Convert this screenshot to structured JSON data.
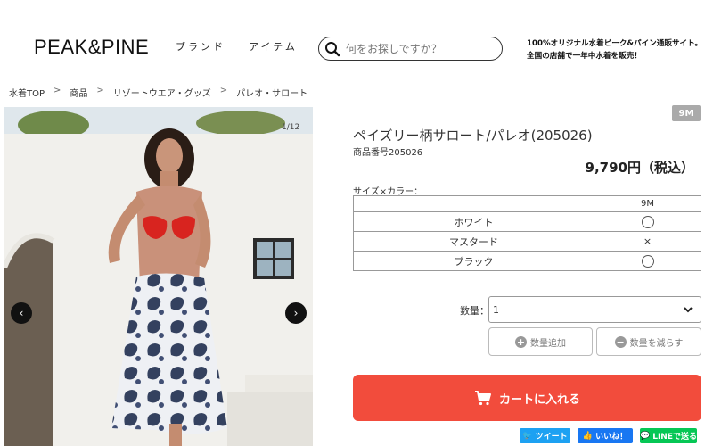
{
  "header": {
    "logo": "PEAK&PINE",
    "nav": [
      "ブランド",
      "アイテム"
    ],
    "search_placeholder": "何をお探しですか？",
    "tagline_1": "100%オリジナル水着ピーク&パイン通販サイト。",
    "tagline_2": "全国の店舗で一年中水着を販売！"
  },
  "breadcrumb": [
    "水着TOP",
    "商品",
    "リゾートウエア・グッズ",
    "パレオ・サロート"
  ],
  "gallery": {
    "counter": "1/12",
    "prev": "‹",
    "next": "›"
  },
  "product": {
    "size_badge": "9M",
    "title": "ペイズリー柄サロート/パレオ(205026)",
    "code": "商品番号205026",
    "price": "9,790円（税込）",
    "variant_label": "サイズ×カラー：",
    "size_header": "9M",
    "variants": [
      {
        "color": "ホワイト",
        "stock": "available"
      },
      {
        "color": "マスタード",
        "stock": "×"
      },
      {
        "color": "ブラック",
        "stock": "available"
      }
    ]
  },
  "quantity": {
    "label": "数量：",
    "value": "1",
    "add_label": "数量追加",
    "sub_label": "数量を減らす"
  },
  "cart": {
    "label": "カートに入れる",
    "color": "#f24c3c"
  },
  "share": {
    "twitter": "ツイート",
    "facebook": "いいね！",
    "line": "LINEで送る"
  }
}
